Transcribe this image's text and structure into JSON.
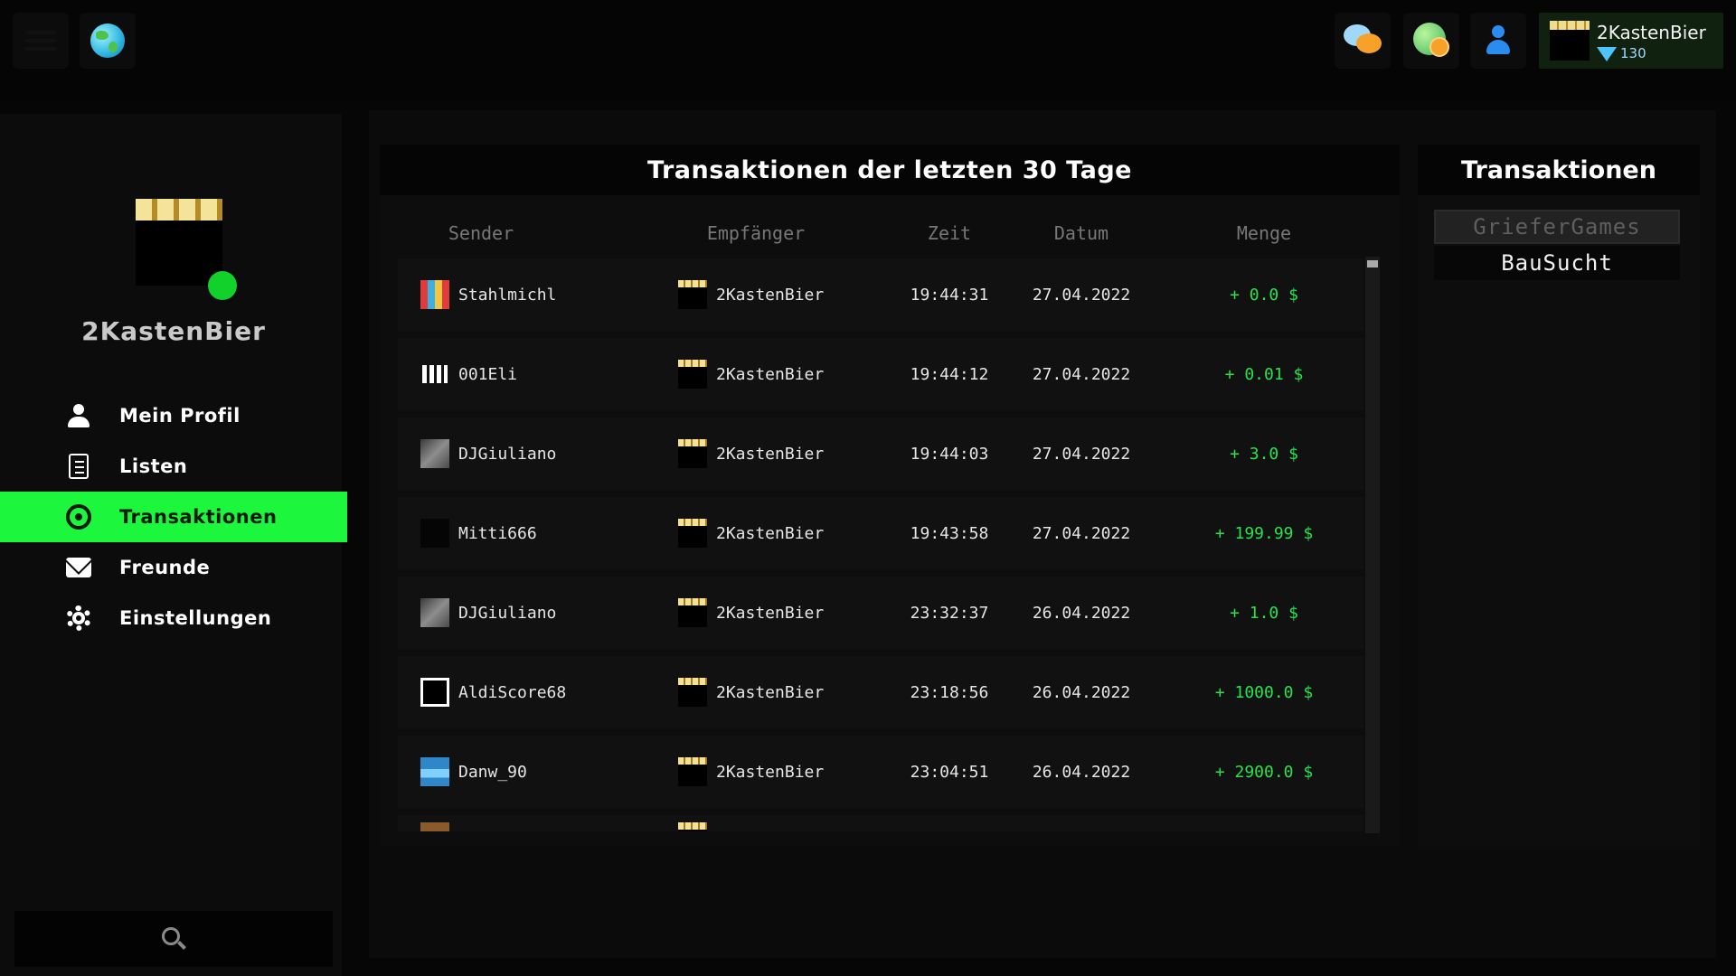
{
  "topbar": {
    "user_name": "2KastenBier",
    "gems": "130"
  },
  "sidebar": {
    "user_name": "2KastenBier",
    "items": [
      {
        "label": "Mein Profil",
        "icon": "person-icon"
      },
      {
        "label": "Listen",
        "icon": "list-icon"
      },
      {
        "label": "Transaktionen",
        "icon": "coin-icon"
      },
      {
        "label": "Freunde",
        "icon": "mail-icon"
      },
      {
        "label": "Einstellungen",
        "icon": "gear-icon"
      }
    ],
    "active_index": 2
  },
  "transactions": {
    "title": "Transaktionen der letzten 30 Tage",
    "columns": {
      "sender": "Sender",
      "recipient": "Empfänger",
      "time": "Zeit",
      "date": "Datum",
      "amount": "Menge"
    },
    "rows": [
      {
        "sender": "Stahlmichl",
        "recipient": "2KastenBier",
        "time": "19:44:31",
        "date": "27.04.2022",
        "amount": "+ 0.0 $"
      },
      {
        "sender": "001Eli",
        "recipient": "2KastenBier",
        "time": "19:44:12",
        "date": "27.04.2022",
        "amount": "+ 0.01 $"
      },
      {
        "sender": "DJGiuliano",
        "recipient": "2KastenBier",
        "time": "19:44:03",
        "date": "27.04.2022",
        "amount": "+ 3.0 $"
      },
      {
        "sender": "Mitti666",
        "recipient": "2KastenBier",
        "time": "19:43:58",
        "date": "27.04.2022",
        "amount": "+ 199.99 $"
      },
      {
        "sender": "DJGiuliano",
        "recipient": "2KastenBier",
        "time": "23:32:37",
        "date": "26.04.2022",
        "amount": "+ 1.0 $"
      },
      {
        "sender": "AldiScore68",
        "recipient": "2KastenBier",
        "time": "23:18:56",
        "date": "26.04.2022",
        "amount": "+ 1000.0 $"
      },
      {
        "sender": "Danw_90",
        "recipient": "2KastenBier",
        "time": "23:04:51",
        "date": "26.04.2022",
        "amount": "+ 2900.0 $"
      }
    ]
  },
  "servers": {
    "title": "Transaktionen",
    "items": [
      "GrieferGames",
      "BauSucht"
    ],
    "selected_index": 0
  }
}
